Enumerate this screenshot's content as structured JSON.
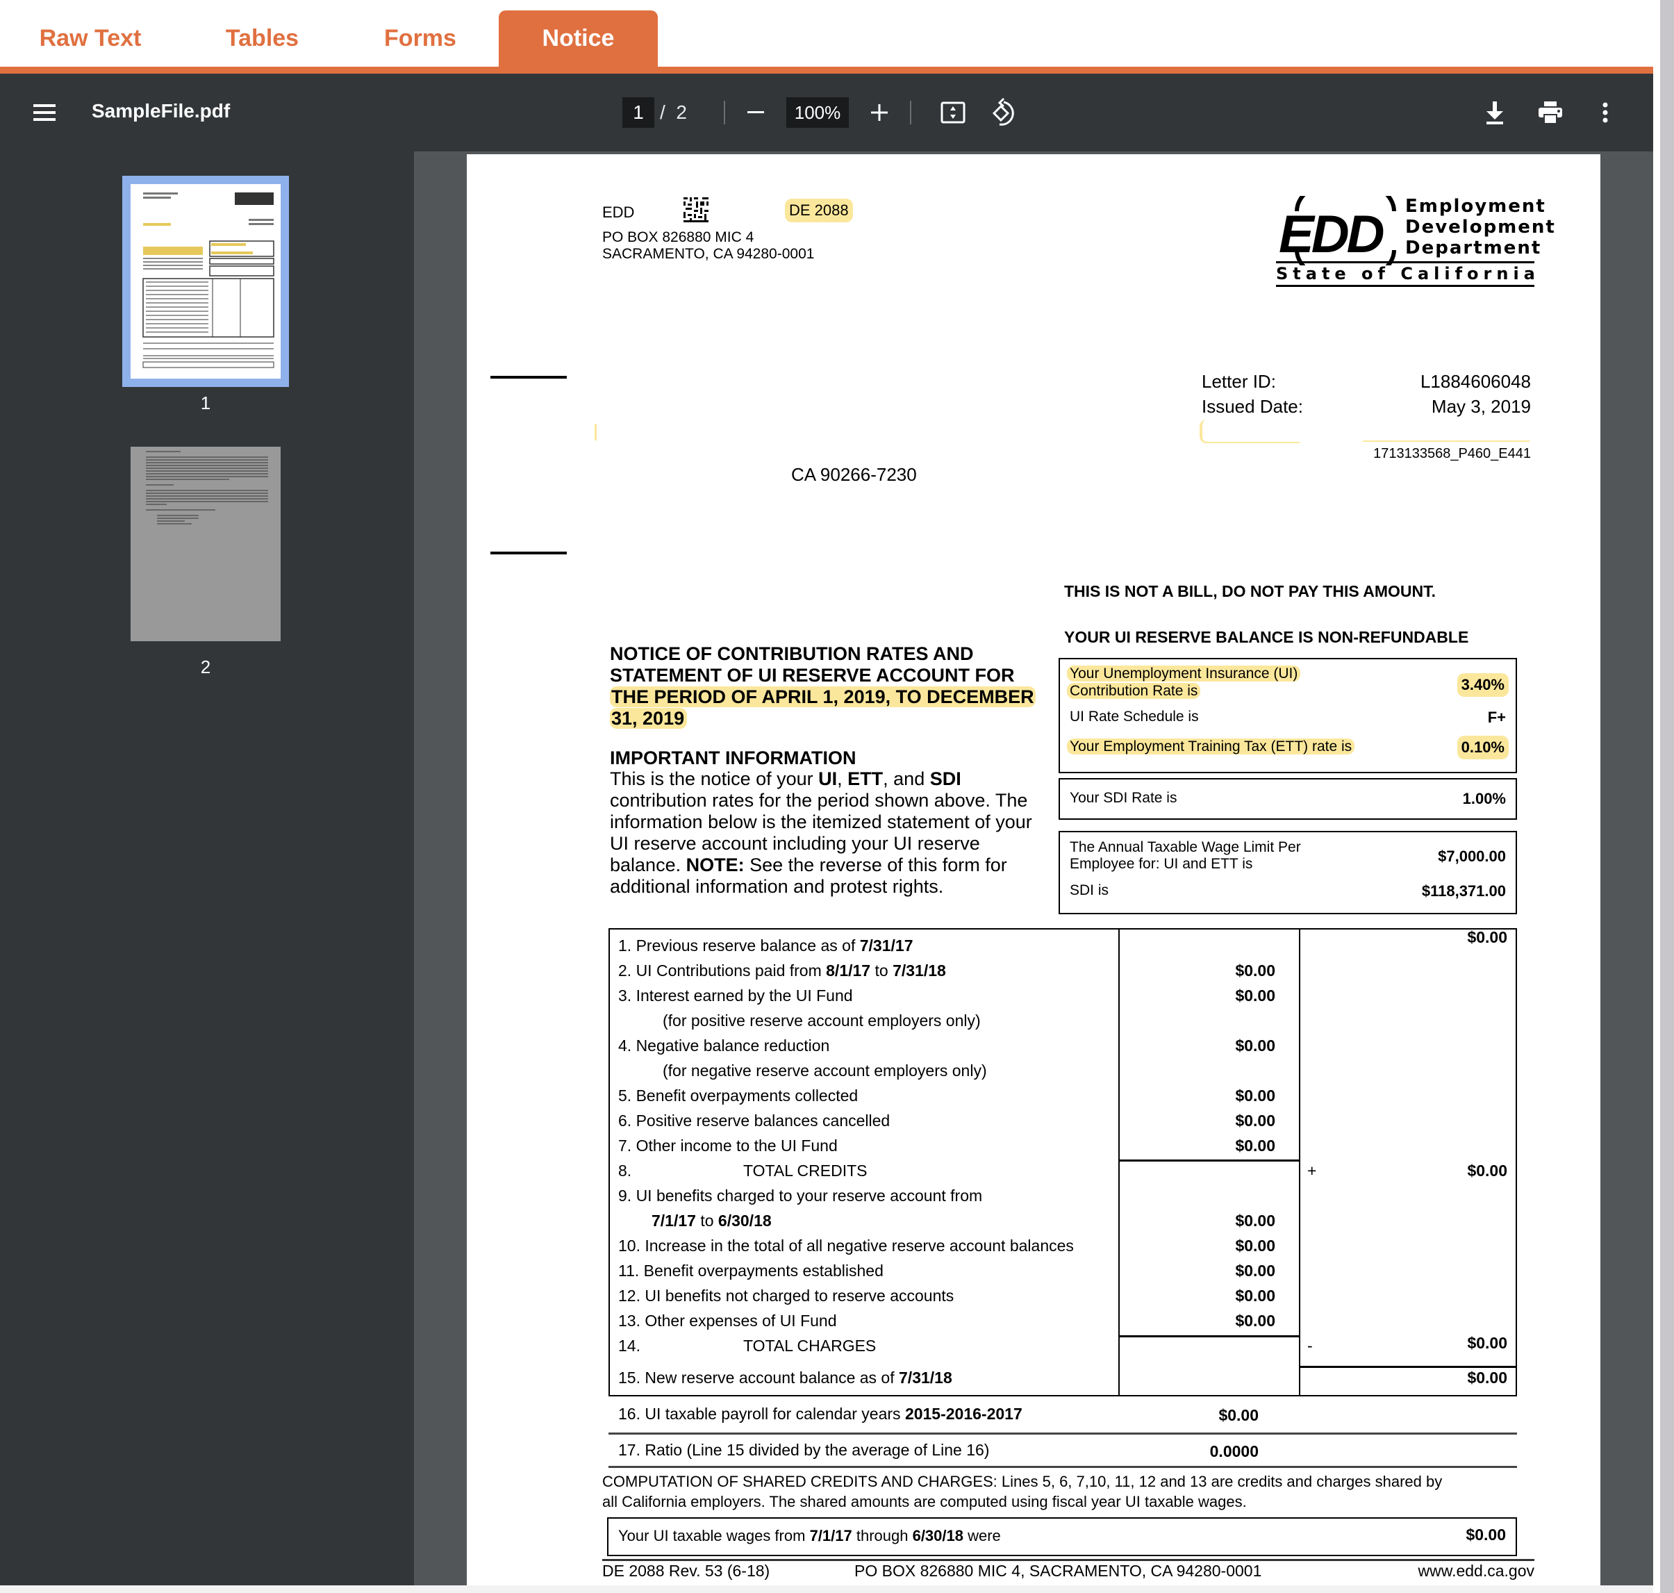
{
  "tabs": [
    {
      "label": "Raw Text",
      "active": false
    },
    {
      "label": "Tables",
      "active": false
    },
    {
      "label": "Forms",
      "active": false
    },
    {
      "label": "Notice",
      "active": true
    }
  ],
  "toolbar": {
    "menu_icon": "hamburger-menu-icon",
    "filename": "SampleFile.pdf",
    "current_page": "1",
    "page_separator": "/",
    "total_pages": "2",
    "zoom_out_icon": "minus-icon",
    "zoom_level": "100%",
    "zoom_in_icon": "plus-icon",
    "fit_icon": "fit-to-page-icon",
    "rotate_icon": "rotate-counterclockwise-icon",
    "download_icon": "download-icon",
    "print_icon": "print-icon",
    "more_icon": "more-vertical-icon"
  },
  "thumbnails": [
    {
      "label": "1",
      "selected": true
    },
    {
      "label": "2",
      "selected": false
    }
  ],
  "document": {
    "sender": {
      "name": "EDD",
      "form_code": "DE 2088",
      "address_line1": "PO BOX 826880 MIC 4",
      "address_line2": "SACRAMENTO, CA 94280-0001"
    },
    "logo": {
      "mark": "EDD",
      "line1": "Employment",
      "line2": "Development",
      "line3": "Department",
      "state": "State of California"
    },
    "letter_id_label": "Letter ID:",
    "letter_id": "L1884606048",
    "issued_date_label": "Issued Date:",
    "issued_date": "May 3, 2019",
    "reference_code": "1713133568_P460_E441",
    "recipient_city_line": "CA  90266-7230",
    "not_a_bill": "THIS IS NOT A BILL, DO NOT PAY THIS AMOUNT.",
    "non_refundable": "YOUR UI RESERVE BALANCE IS NON-REFUNDABLE",
    "notice_title_plain": "NOTICE OF CONTRIBUTION RATES AND STATEMENT OF UI RESERVE ACCOUNT FOR",
    "notice_title_line1": "NOTICE OF CONTRIBUTION RATES AND",
    "notice_title_line2": "STATEMENT OF UI RESERVE ACCOUNT FOR",
    "notice_title_line3": "THE PERIOD OF APRIL 1, 2019, TO DECEMBER",
    "notice_title_line4": "31, 2019",
    "important_heading": "IMPORTANT INFORMATION",
    "important_lines": [
      "contribution rates for the period shown above. The",
      "information below is the itemized statement of your",
      "UI reserve account including your UI reserve"
    ],
    "important_line1_a": "This is the notice of your ",
    "important_line1_ui": "UI",
    "important_line1_b": ", ",
    "important_line1_ett": "ETT",
    "important_line1_c": ", and ",
    "important_line1_sdi": "SDI",
    "important_line5_a": "balance. ",
    "important_line5_note": "NOTE:",
    "important_line5_b": " See the reverse of this form for",
    "important_line6": "additional information and protest rights.",
    "rates": {
      "ui_rate_label_1": "Your Unemployment Insurance (UI)",
      "ui_rate_label_2": "Contribution Rate is",
      "ui_rate": "3.40%",
      "schedule_label": "UI Rate Schedule is",
      "schedule": "F+",
      "ett_label": "Your Employment Training Tax (ETT) rate is",
      "ett_rate": "0.10%",
      "sdi_label": "Your SDI Rate is",
      "sdi_rate": "1.00%",
      "wage_limit_label_1": "The Annual Taxable Wage Limit Per",
      "wage_limit_label_2": "Employee for: UI and ETT is",
      "wage_limit": "$7,000.00",
      "sdi_limit_label": "SDI is",
      "sdi_limit": "$118,371.00"
    },
    "statement_rows": [
      {
        "text": "1. Previous reserve balance as of ",
        "bold": "7/31/17",
        "mid": "",
        "right": "$0.00"
      },
      {
        "text": "2. UI Contributions paid from ",
        "bold": "8/1/17",
        "text2": " to ",
        "bold2": "7/31/18",
        "mid": "$0.00",
        "right": ""
      },
      {
        "text": "3. Interest earned by the UI Fund",
        "mid": "$0.00",
        "right": ""
      },
      {
        "text": "(for positive reserve account employers only)",
        "indent": true,
        "mid": "",
        "right": ""
      },
      {
        "text": "4. Negative balance reduction",
        "mid": "$0.00",
        "right": ""
      },
      {
        "text": "(for negative reserve account employers only)",
        "indent": true,
        "mid": "",
        "right": ""
      },
      {
        "text": "5. Benefit overpayments collected",
        "mid": "$0.00",
        "right": ""
      },
      {
        "text": "6. Positive reserve balances cancelled",
        "mid": "$0.00",
        "right": ""
      },
      {
        "text": "7. Other income to the UI Fund",
        "mid": "$0.00",
        "right": ""
      },
      {
        "text": "8.",
        "label": "TOTAL CREDITS",
        "sign": "+",
        "mid": "",
        "right": "$0.00"
      },
      {
        "text": "9. UI benefits charged to your reserve account from",
        "mid": "",
        "right": ""
      },
      {
        "text": "",
        "bold": "7/1/17",
        "text2": " to ",
        "bold2": "6/30/18",
        "indent": true,
        "mid": "$0.00",
        "right": ""
      },
      {
        "text": "10. Increase in the total of all negative reserve account balances",
        "mid": "$0.00",
        "right": ""
      },
      {
        "text": "11. Benefit overpayments established",
        "mid": "$0.00",
        "right": ""
      },
      {
        "text": "12. UI benefits not charged to reserve accounts",
        "mid": "$0.00",
        "right": ""
      },
      {
        "text": "13. Other expenses of UI Fund",
        "mid": "$0.00",
        "right": ""
      },
      {
        "text": "14.",
        "label": "TOTAL CHARGES",
        "sign": "-",
        "mid": "",
        "right": "$0.00"
      },
      {
        "text": "15. New reserve account balance as of ",
        "bold": "7/31/18",
        "mid": "",
        "right": "$0.00"
      }
    ],
    "line16_text": "16. UI taxable payroll for calendar years ",
    "line16_bold": "2015-2016-2017",
    "line16_value": "$0.00",
    "line17_text": "17. Ratio (Line 15 divided by the average of Line 16)",
    "line17_value": "0.0000",
    "shared_line1": "COMPUTATION OF SHARED CREDITS AND CHARGES: Lines 5, 6, 7,10, 11, 12 and 13 are credits and charges shared by",
    "shared_line2": "all California employers. The shared amounts are computed using fiscal year UI taxable wages.",
    "wages_text_a": "Your UI taxable wages from ",
    "wages_bold_a": "7/1/17",
    "wages_text_b": " through ",
    "wages_bold_b": "6/30/18",
    "wages_text_c": " were",
    "wages_value": "$0.00",
    "footer_form": "DE 2088 Rev. 53 (6-18)",
    "footer_address": "PO BOX 826880 MIC 4, SACRAMENTO, CA 94280-0001",
    "footer_url": "www.edd.ca.gov"
  },
  "colors": {
    "accent": "#e07040",
    "toolbar_bg": "#323639",
    "viewer_bg": "#525659",
    "highlight": "#fbe79c",
    "thumb_selected": "#8fb1eb"
  }
}
